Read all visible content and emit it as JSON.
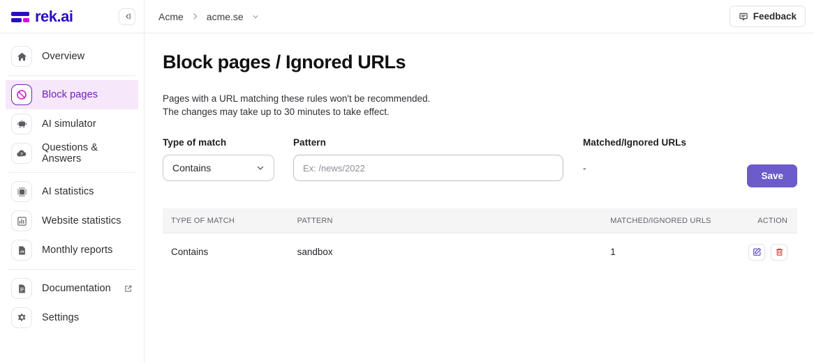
{
  "brand": {
    "name": "rek.ai",
    "logo_icon": "rek-ai-logo",
    "collapse_icon": "collapse-sidebar-icon",
    "primary_color": "#2b0ec4",
    "accent_color": "#e000e0",
    "active_bg": "#f7e7fb",
    "save_button_color": "#6b5bcb"
  },
  "sidebar": {
    "groups": [
      {
        "items": [
          {
            "label": "Overview",
            "icon": "home-icon",
            "active": false,
            "external": false
          }
        ]
      },
      {
        "items": [
          {
            "label": "Block pages",
            "icon": "block-icon",
            "active": true,
            "external": false
          },
          {
            "label": "AI simulator",
            "icon": "robot-icon",
            "active": false,
            "external": false
          },
          {
            "label": "Questions & Answers",
            "icon": "question-cloud-icon",
            "active": false,
            "external": false
          }
        ]
      },
      {
        "items": [
          {
            "label": "AI statistics",
            "icon": "chip-icon",
            "active": false,
            "external": false
          },
          {
            "label": "Website statistics",
            "icon": "bar-chart-icon",
            "active": false,
            "external": false
          },
          {
            "label": "Monthly reports",
            "icon": "report-document-icon",
            "active": false,
            "external": false
          }
        ]
      },
      {
        "items": [
          {
            "label": "Documentation",
            "icon": "document-icon",
            "active": false,
            "external": true
          },
          {
            "label": "Settings",
            "icon": "gear-icon",
            "active": false,
            "external": false
          }
        ]
      }
    ]
  },
  "topbar": {
    "breadcrumb": [
      {
        "label": "Acme"
      },
      {
        "label": "acme.se"
      }
    ],
    "breadcrumb_separator_icon": "chevron-right-icon",
    "breadcrumb_caret_icon": "chevron-down-icon",
    "feedback": {
      "label": "Feedback",
      "icon": "message-icon"
    }
  },
  "page": {
    "title": "Block pages / Ignored URLs",
    "description_line1": "Pages with a URL matching these rules won't be recommended.",
    "description_line2": "The changes may take up to 30 minutes to take effect."
  },
  "form": {
    "type_of_match": {
      "label": "Type of match",
      "value": "Contains",
      "caret_icon": "chevron-down-icon",
      "options": [
        "Contains"
      ]
    },
    "pattern": {
      "label": "Pattern",
      "value": "",
      "placeholder": "Ex: /news/2022"
    },
    "matched_ignored_urls": {
      "label": "Matched/Ignored URLs",
      "value": "-"
    },
    "save": {
      "label": "Save"
    }
  },
  "table": {
    "columns": [
      "TYPE OF MATCH",
      "PATTERN",
      "MATCHED/IGNORED URLS",
      "ACTION"
    ],
    "rows": [
      {
        "type_of_match": "Contains",
        "pattern": "sandbox",
        "matched_ignored_urls": "1",
        "edit_icon": "edit-pencil-icon",
        "delete_icon": "trash-icon"
      }
    ]
  }
}
